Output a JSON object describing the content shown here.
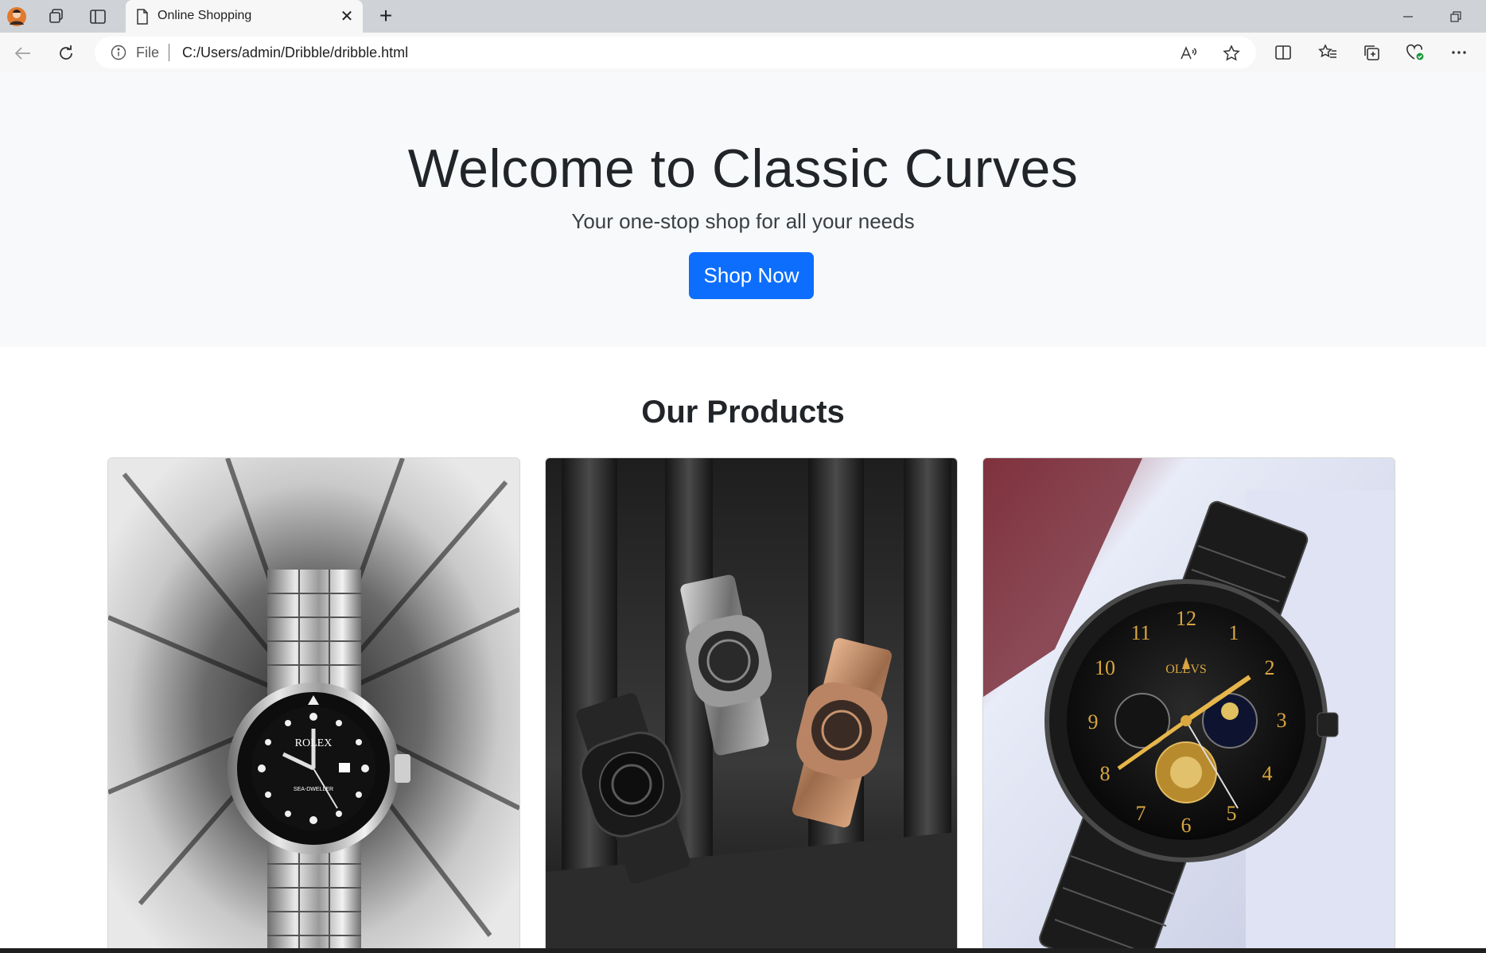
{
  "browser": {
    "tab_title": "Online Shopping",
    "address": {
      "file_label": "File",
      "url": "C:/Users/admin/Dribble/dribble.html"
    }
  },
  "hero": {
    "title": "Welcome to Classic Curves",
    "subtitle": "Your one-stop shop for all your needs",
    "cta_label": "Shop Now",
    "cta_color": "#0d6efd",
    "background": "#f8f9fa"
  },
  "products": {
    "heading": "Our Products",
    "items": [
      {
        "image": "silver-dive-watch-on-ink-splash",
        "logo_text": "ROLEX",
        "dial_text": "SEA-DWELLER"
      },
      {
        "image": "three-skeleton-watches-black-steel-rose-gold"
      },
      {
        "image": "black-gold-chronograph-in-box",
        "logo_text": "OLEVS"
      }
    ]
  }
}
